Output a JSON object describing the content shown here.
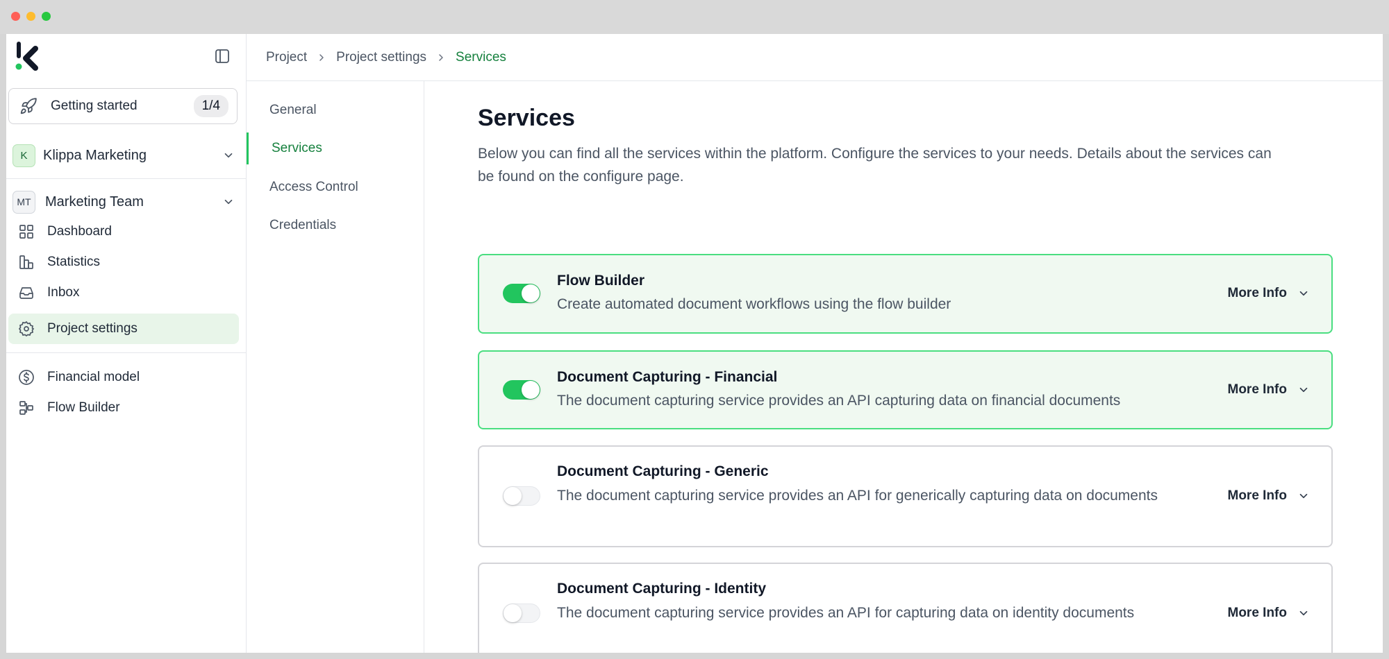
{
  "window": {
    "controls": [
      "close",
      "minimize",
      "maximize"
    ]
  },
  "sidebar": {
    "getting_started": {
      "label": "Getting started",
      "progress": "1/4"
    },
    "workspace": {
      "avatar": "K",
      "name": "Klippa Marketing"
    },
    "team": {
      "avatar": "MT",
      "name": "Marketing Team"
    },
    "items": [
      {
        "label": "Dashboard",
        "icon": "dashboard-icon"
      },
      {
        "label": "Statistics",
        "icon": "statistics-icon"
      },
      {
        "label": "Inbox",
        "icon": "inbox-icon"
      },
      {
        "label": "Project settings",
        "icon": "gear-icon",
        "active": true
      }
    ],
    "extra_items": [
      {
        "label": "Financial model",
        "icon": "dollar-icon"
      },
      {
        "label": "Flow Builder",
        "icon": "flow-builder-icon"
      }
    ]
  },
  "breadcrumb": [
    "Project",
    "Project settings",
    "Services"
  ],
  "subnav": [
    {
      "label": "General"
    },
    {
      "label": "Services",
      "active": true
    },
    {
      "label": "Access Control"
    },
    {
      "label": "Credentials"
    }
  ],
  "main": {
    "title": "Services",
    "description": "Below you can find all the services within the platform. Configure the services to your needs. Details about the services can be found on the configure page.",
    "more_info_label": "More Info",
    "services": [
      {
        "title": "Flow Builder",
        "description": "Create automated document workflows using the flow builder",
        "enabled": true
      },
      {
        "title": "Document Capturing - Financial",
        "description": "The document capturing service provides an API capturing data on financial documents",
        "enabled": true
      },
      {
        "title": "Document Capturing - Generic",
        "description": "The document capturing service provides an API for generically capturing data on documents",
        "enabled": false
      },
      {
        "title": "Document Capturing - Identity",
        "description": "The document capturing service provides an API for capturing data on identity documents",
        "enabled": false
      }
    ]
  },
  "colors": {
    "accent": "#22c55e",
    "accent_text": "#15803d",
    "active_bg": "#e8f5e9",
    "enabled_card_bg": "#f0f9f1"
  }
}
